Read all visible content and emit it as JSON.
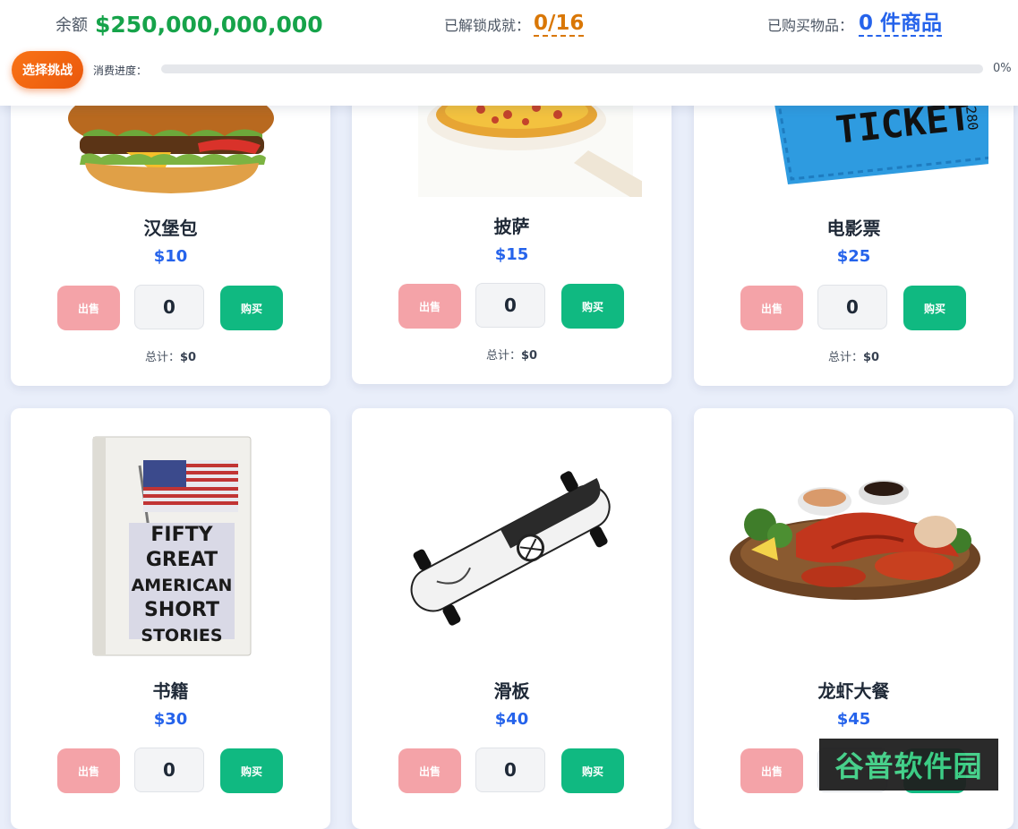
{
  "header": {
    "balance_label": "余额",
    "balance_value": "$250,000,000,000",
    "achievements_label": "已解锁成就：",
    "achievements_value": "0/16",
    "purchased_label": "已购买物品：",
    "purchased_value": "0 件商品",
    "challenge_button": "选择挑战",
    "progress_label": "消费进度：",
    "progress_percent_text": "0%",
    "progress_fraction": 0
  },
  "products": [
    {
      "name": "汉堡包",
      "price": "$10",
      "sell_label": "出售",
      "quantity": "0",
      "buy_label": "购买",
      "total_label": "总计：",
      "total_value": "$0",
      "image": "burger-image"
    },
    {
      "name": "披萨",
      "price": "$15",
      "sell_label": "出售",
      "quantity": "0",
      "buy_label": "购买",
      "total_label": "总计：",
      "total_value": "$0",
      "image": "pizza-image"
    },
    {
      "name": "电影票",
      "price": "$25",
      "sell_label": "出售",
      "quantity": "0",
      "buy_label": "购买",
      "total_label": "总计：",
      "total_value": "$0",
      "image": "movie-ticket-image",
      "image_text": "TICKET 2280"
    },
    {
      "name": "书籍",
      "price": "$30",
      "sell_label": "出售",
      "quantity": "0",
      "buy_label": "购买",
      "image": "book-image",
      "image_text": "FIFTY GREAT AMERICAN SHORT STORIES"
    },
    {
      "name": "滑板",
      "price": "$40",
      "sell_label": "出售",
      "quantity": "0",
      "buy_label": "购买",
      "image": "skateboard-image"
    },
    {
      "name": "龙虾大餐",
      "price": "$45",
      "sell_label": "出售",
      "image": "lobster-dinner-image"
    }
  ],
  "watermark": "谷普软件园",
  "colors": {
    "balance": "#16a34a",
    "achievements": "#d97706",
    "purchased": "#2563eb",
    "price": "#2563eb",
    "sell_button": "#f4a3a8",
    "buy_button": "#10b981",
    "challenge_button": "#f97316"
  }
}
